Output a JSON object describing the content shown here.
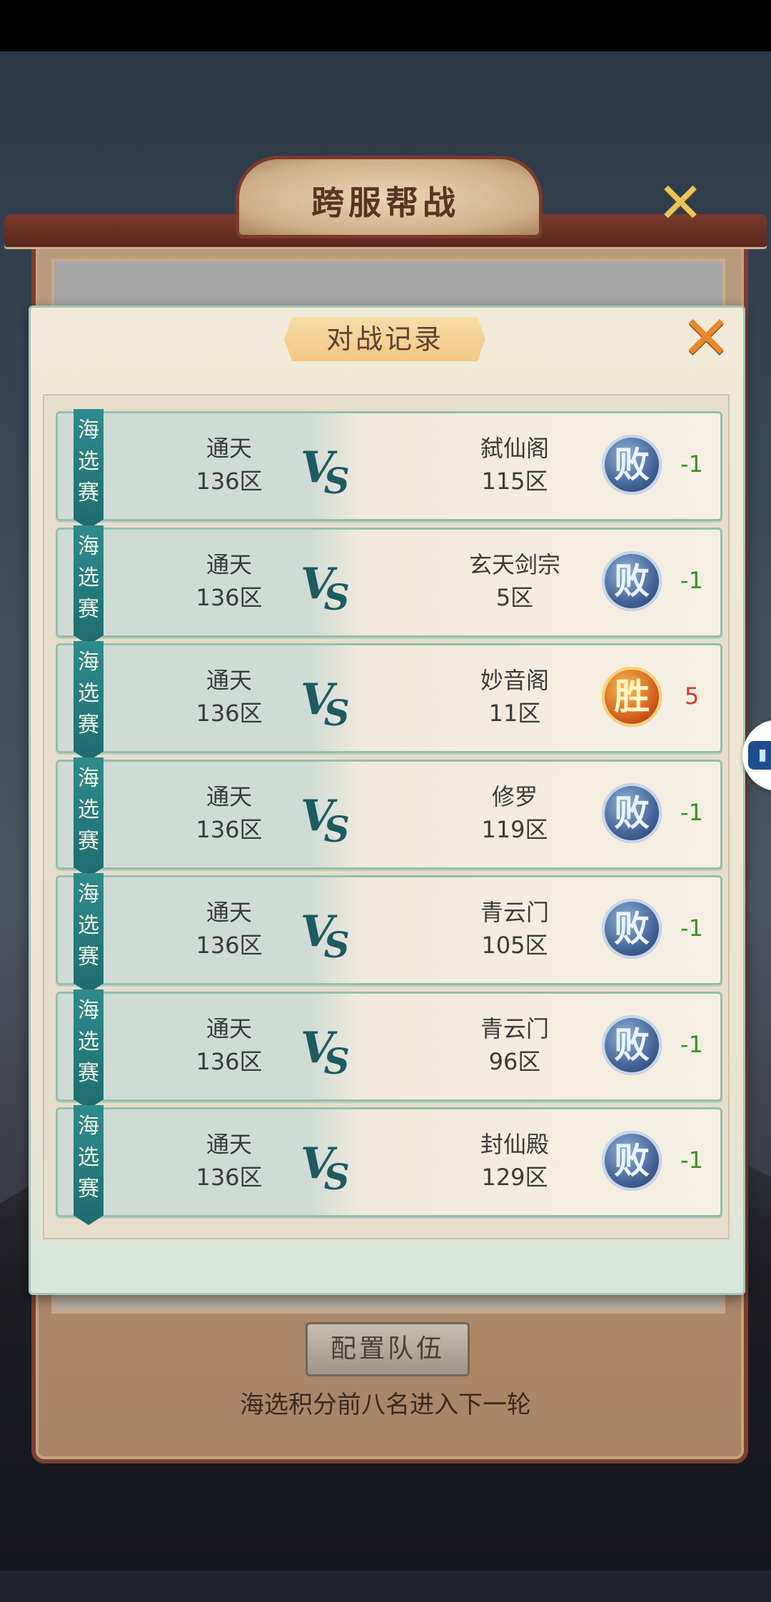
{
  "background_panel": {
    "title": "跨服帮战",
    "close_glyph": "✕",
    "config_button": "配置队伍",
    "hint": "海选积分前八名进入下一轮"
  },
  "dialog": {
    "title": "对战记录",
    "close_glyph": "✕"
  },
  "vs_label": "VS",
  "records": [
    {
      "stage": "海选赛",
      "team_a_name": "通天",
      "team_a_zone": "136区",
      "team_b_name": "弑仙阁",
      "team_b_zone": "115区",
      "result": "败",
      "score": "-1",
      "score_color": "#3f8f2a"
    },
    {
      "stage": "海选赛",
      "team_a_name": "通天",
      "team_a_zone": "136区",
      "team_b_name": "玄天剑宗",
      "team_b_zone": "5区",
      "result": "败",
      "score": "-1",
      "score_color": "#3f8f2a"
    },
    {
      "stage": "海选赛",
      "team_a_name": "通天",
      "team_a_zone": "136区",
      "team_b_name": "妙音阁",
      "team_b_zone": "11区",
      "result": "胜",
      "score": "5",
      "score_color": "#d6382a"
    },
    {
      "stage": "海选赛",
      "team_a_name": "通天",
      "team_a_zone": "136区",
      "team_b_name": "修罗",
      "team_b_zone": "119区",
      "result": "败",
      "score": "-1",
      "score_color": "#3f8f2a"
    },
    {
      "stage": "海选赛",
      "team_a_name": "通天",
      "team_a_zone": "136区",
      "team_b_name": "青云门",
      "team_b_zone": "105区",
      "result": "败",
      "score": "-1",
      "score_color": "#3f8f2a"
    },
    {
      "stage": "海选赛",
      "team_a_name": "通天",
      "team_a_zone": "136区",
      "team_b_name": "青云门",
      "team_b_zone": "96区",
      "result": "败",
      "score": "-1",
      "score_color": "#3f8f2a"
    },
    {
      "stage": "海选赛",
      "team_a_name": "通天",
      "team_a_zone": "136区",
      "team_b_name": "封仙殿",
      "team_b_zone": "129区",
      "result": "败",
      "score": "-1",
      "score_color": "#3f8f2a"
    }
  ],
  "colors": {
    "win_badge": "#d25a1d",
    "lose_badge": "#3f5f92",
    "stage_tag": "#2e8b8c"
  },
  "icons": {
    "side_floating_button": "audio-wave-icon"
  }
}
